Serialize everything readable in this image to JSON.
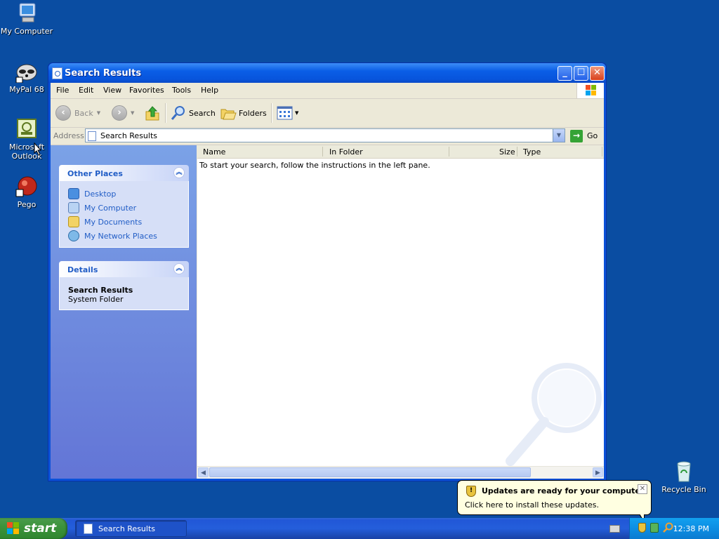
{
  "desktop": {
    "icons": [
      {
        "label": "My Computer"
      },
      {
        "label": "MyPal 68"
      },
      {
        "label": "Microsoft Outlook"
      },
      {
        "label": "Pego"
      },
      {
        "label": "Recycle Bin"
      }
    ]
  },
  "window": {
    "title": "Search Results",
    "menu": [
      "File",
      "Edit",
      "View",
      "Favorites",
      "Tools",
      "Help"
    ],
    "toolbar": {
      "back_label": "Back",
      "search_label": "Search",
      "folders_label": "Folders"
    },
    "address": {
      "label": "Address",
      "value": "Search Results",
      "go_label": "Go"
    },
    "other_places": {
      "title": "Other Places",
      "items": [
        {
          "label": "Desktop"
        },
        {
          "label": "My Computer"
        },
        {
          "label": "My Documents"
        },
        {
          "label": "My Network Places"
        }
      ]
    },
    "details": {
      "title": "Details",
      "name": "Search Results",
      "type": "System Folder"
    },
    "columns": [
      "Name",
      "In Folder",
      "Size",
      "Type"
    ],
    "hint": "To start your search, follow the instructions in the left pane."
  },
  "balloon": {
    "title": "Updates are ready for your computer",
    "message": "Click here to install these updates."
  },
  "taskbar": {
    "start_label": "start",
    "task_label": "Search Results",
    "clock": "12:38 PM"
  }
}
